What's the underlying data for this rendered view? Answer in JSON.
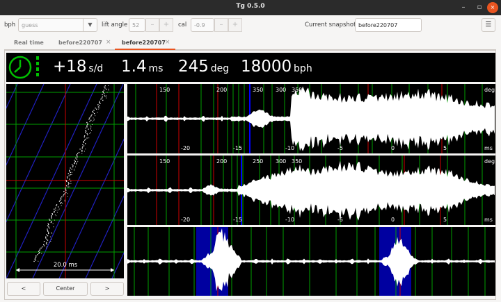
{
  "window": {
    "title": "Tg 0.5.0",
    "minimize_glyph": "–",
    "restore_glyph": "▫",
    "close_glyph": "×"
  },
  "toolbar": {
    "bph_label": "bph",
    "bph_value": "guess",
    "lift_angle_label": "lift angle",
    "lift_angle_value": "52",
    "cal_label": "cal",
    "cal_value": "-0.9",
    "minus_glyph": "–",
    "plus_glyph": "+",
    "snapshot_label": "Current snapshot:",
    "snapshot_value": "before220707",
    "menu_glyph": "☰"
  },
  "tabs": [
    {
      "label": "Real time",
      "closable": false,
      "active": false
    },
    {
      "label": "before220707",
      "closable": true,
      "active": false
    },
    {
      "label": "before220707",
      "closable": true,
      "active": true
    }
  ],
  "tab_close_glyph": "×",
  "readout": {
    "rate_value": "+18",
    "rate_unit": "s/d",
    "beat_error_value": "1.4",
    "beat_error_unit": "ms",
    "amplitude_value": "245",
    "amplitude_unit": "deg",
    "bph_value": "18000",
    "bph_unit": "bph",
    "status_color": "#00c000"
  },
  "paper": {
    "scale_label": "20.0 ms"
  },
  "nav": {
    "prev_label": "<",
    "center_label": "Center",
    "next_label": ">"
  },
  "scope_top": {
    "deg_labels": [
      "150",
      "200",
      "250",
      "300",
      "350"
    ],
    "deg_unit": "deg",
    "ms_labels": [
      "-20",
      "-15",
      "-10",
      "-5",
      "0",
      "5"
    ],
    "ms_unit": "ms"
  },
  "scope_mid": {
    "deg_labels": [
      "150",
      "200",
      "250",
      "300",
      "350"
    ],
    "deg_unit": "deg",
    "ms_labels": [
      "-20",
      "-15",
      "-10",
      "-5",
      "0",
      "5"
    ],
    "ms_unit": "ms"
  },
  "colors": {
    "accent": "#e95420",
    "grid_green": "#00b000",
    "marker_red": "#e00000",
    "marker_blue": "#0000ff",
    "highlight_blue": "#0000a0"
  }
}
